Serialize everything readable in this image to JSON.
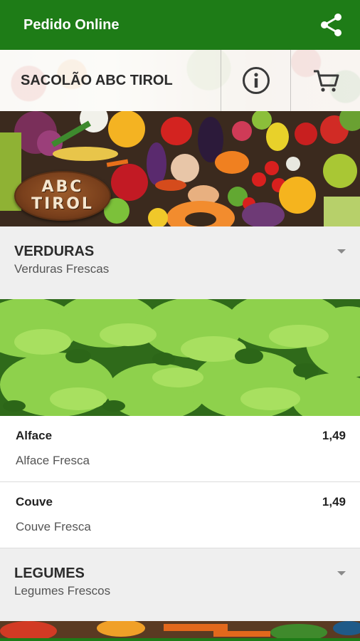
{
  "appbar": {
    "title": "Pedido Online",
    "share_icon": "share-icon"
  },
  "store": {
    "name": "SACOLÃO ABC TIROL",
    "info_icon": "info-icon",
    "cart_icon": "cart-icon"
  },
  "banner": {
    "logo_line1": "ABC",
    "logo_line2": "TIROL"
  },
  "categories": [
    {
      "title": "VERDURAS",
      "subtitle": "Verduras Frescas",
      "items": [
        {
          "name": "Alface",
          "description": "Alface Fresca",
          "price": "1,49"
        },
        {
          "name": "Couve",
          "description": "Couve Fresca",
          "price": "1,49"
        }
      ]
    },
    {
      "title": "LEGUMES",
      "subtitle": "Legumes Frescos"
    }
  ],
  "colors": {
    "primary": "#1e7c17",
    "header_bg": "#efefef"
  }
}
